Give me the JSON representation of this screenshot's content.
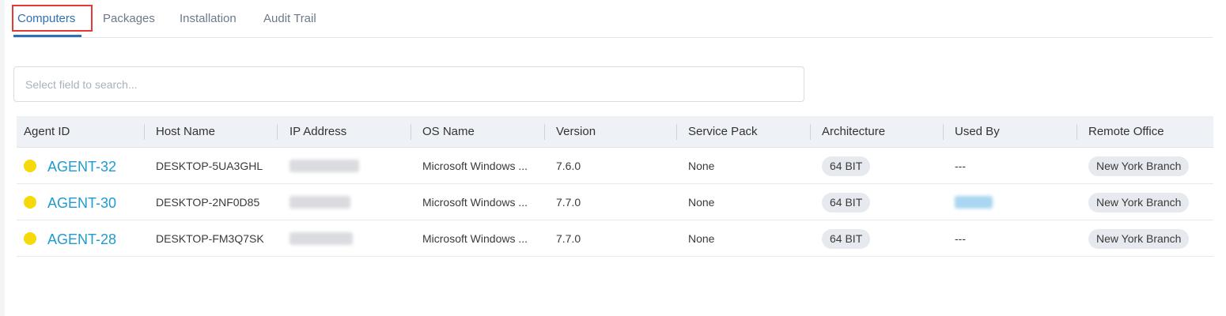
{
  "tabs": [
    {
      "label": "Computers",
      "active": true
    },
    {
      "label": "Packages",
      "active": false
    },
    {
      "label": "Installation",
      "active": false
    },
    {
      "label": "Audit Trail",
      "active": false
    }
  ],
  "search": {
    "placeholder": "Select field to search..."
  },
  "table": {
    "columns": [
      "Agent ID",
      "Host Name",
      "IP Address",
      "OS Name",
      "Version",
      "Service Pack",
      "Architecture",
      "Used By",
      "Remote Office"
    ],
    "rows": [
      {
        "status": "warning",
        "agent_id": "AGENT-32",
        "host_name": "DESKTOP-5UA3GHL",
        "ip_address": "",
        "os_name": "Microsoft Windows ...",
        "version": "7.6.0",
        "service_pack": "None",
        "architecture": "64 BIT",
        "used_by": "---",
        "remote_office": "New York Branch"
      },
      {
        "status": "warning",
        "agent_id": "AGENT-30",
        "host_name": "DESKTOP-2NF0D85",
        "ip_address": "",
        "os_name": "Microsoft Windows ...",
        "version": "7.7.0",
        "service_pack": "None",
        "architecture": "64 BIT",
        "used_by": "",
        "remote_office": "New York Branch"
      },
      {
        "status": "warning",
        "agent_id": "AGENT-28",
        "host_name": "DESKTOP-FM3Q7SK",
        "ip_address": "",
        "os_name": "Microsoft Windows ...",
        "version": "7.7.0",
        "service_pack": "None",
        "architecture": "64 BIT",
        "used_by": "---",
        "remote_office": "New York Branch"
      }
    ]
  },
  "colors": {
    "accent": "#2f6fb5",
    "link": "#1f9bd1",
    "status_warning": "#f5d90a",
    "highlight": "#e53935"
  }
}
